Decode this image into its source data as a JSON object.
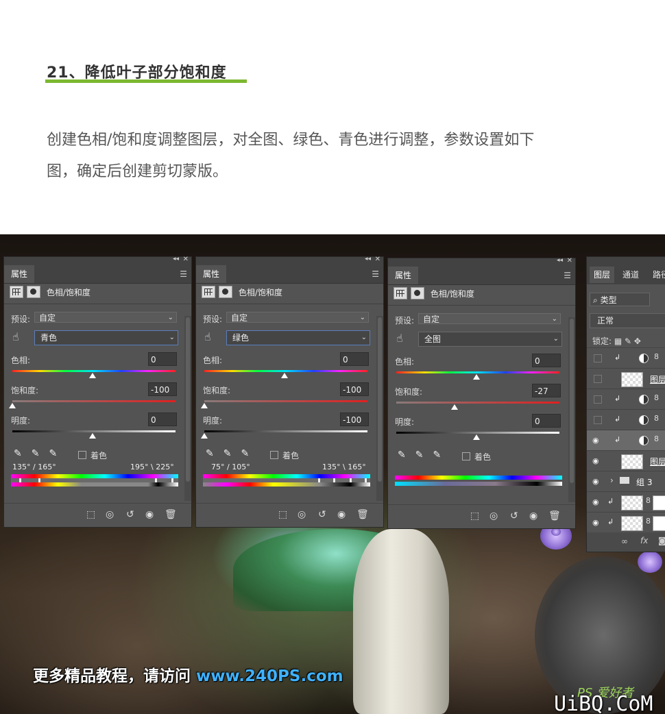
{
  "article": {
    "title": "21、降低叶子部分饱和度",
    "body_line1": "创建色相/饱和度调整图层，对全图、绿色、青色进行调整，参数设置如下",
    "body_line2": "图，确定后创建剪切蒙版。"
  },
  "colors": {
    "title_underline": "#7cb82f",
    "panel_bg": "#535353",
    "promo_url": "#3fb2ff"
  },
  "panels": [
    {
      "tab": "属性",
      "header": "色相/饱和度",
      "preset_label": "预设:",
      "preset_value": "自定",
      "channel": "青色",
      "hue_label": "色相:",
      "hue_value": "0",
      "sat_label": "饱和度:",
      "sat_value": "-100",
      "light_label": "明度:",
      "light_value": "0",
      "colorize_label": "着色",
      "range_left": "135° / 165°",
      "range_right": "195° \\ 225°"
    },
    {
      "tab": "属性",
      "header": "色相/饱和度",
      "preset_label": "预设:",
      "preset_value": "自定",
      "channel": "绿色",
      "hue_label": "色相:",
      "hue_value": "0",
      "sat_label": "饱和度:",
      "sat_value": "-100",
      "light_label": "明度:",
      "light_value": "-100",
      "colorize_label": "着色",
      "range_left": "75° / 105°",
      "range_right": "135° \\ 165°"
    },
    {
      "tab": "属性",
      "header": "色相/饱和度",
      "preset_label": "预设:",
      "preset_value": "自定",
      "channel": "全图",
      "hue_label": "色相:",
      "hue_value": "0",
      "sat_label": "饱和度:",
      "sat_value": "-27",
      "light_label": "明度:",
      "light_value": "0",
      "colorize_label": "着色"
    }
  ],
  "layers_panel": {
    "tab_layers": "图层",
    "tab_channels": "通道",
    "tab_paths": "路径",
    "filter": "类型",
    "blend_mode": "正常",
    "lock_label": "锁定:",
    "layer_name_1": "图层",
    "layer_name_2": "图层",
    "group_name": "组 3",
    "fx_label": "fx"
  },
  "promo": {
    "text": "更多精品教程，请访问",
    "url": "www.240PS.com"
  },
  "watermark": {
    "ps": "PS 爱好者",
    "site": "UiBQ.CoM"
  }
}
